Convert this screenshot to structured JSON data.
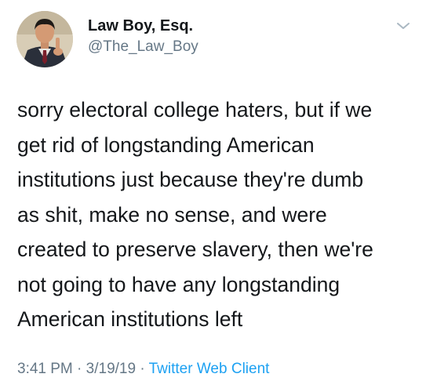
{
  "author": {
    "display_name": "Law Boy, Esq.",
    "handle": "@The_Law_Boy"
  },
  "tweet": {
    "lines": [
      "sorry electoral college haters, but if we",
      "get rid of longstanding American",
      "institutions just because they're dumb",
      "as shit, make no sense, and were",
      "created to preserve slavery, then we're",
      "not going to have any longstanding",
      "American institutions left"
    ]
  },
  "meta": {
    "time": "3:41 PM",
    "separator": "·",
    "date": "3/19/19",
    "source": "Twitter Web Client"
  },
  "icons": {
    "menu": "chevron-down-icon"
  },
  "colors": {
    "text": "#14171a",
    "secondary": "#657786",
    "link": "#1da1f2"
  }
}
